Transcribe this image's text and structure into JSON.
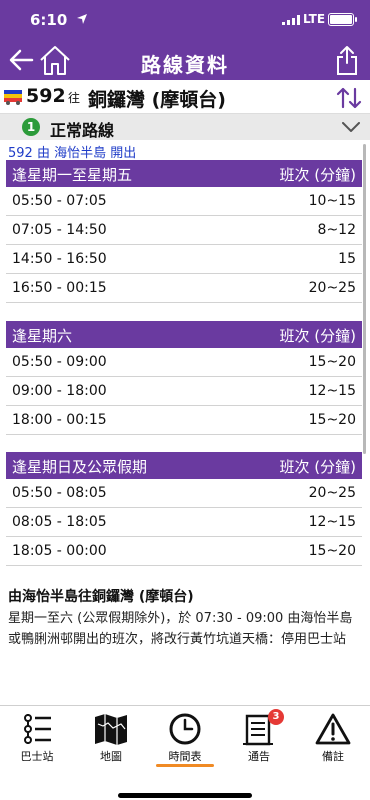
{
  "status_bar": {
    "time": "6:10",
    "network": "LTE",
    "battery_level": 1.0
  },
  "nav": {
    "title": "路線資料",
    "back_icon": "arrow-left-icon",
    "home_icon": "home-icon",
    "share_icon": "share-icon"
  },
  "route": {
    "number": "592",
    "to_word": "往",
    "destination": "銅鑼灣 (摩頓台)"
  },
  "variant": {
    "number": "1",
    "label": "正常路線"
  },
  "departure_label": "592 由 海怡半島 開出",
  "timetable": [
    {
      "title": "逢星期一至星期五",
      "unit": "班次 (分鐘)",
      "rows": [
        {
          "time": "05:50 - 07:05",
          "freq": "10~15"
        },
        {
          "time": "07:05 - 14:50",
          "freq": "8~12"
        },
        {
          "time": "14:50 - 16:50",
          "freq": "15"
        },
        {
          "time": "16:50 - 00:15",
          "freq": "20~25"
        }
      ]
    },
    {
      "title": "逢星期六",
      "unit": "班次 (分鐘)",
      "rows": [
        {
          "time": "05:50 - 09:00",
          "freq": "15~20"
        },
        {
          "time": "09:00 - 18:00",
          "freq": "12~15"
        },
        {
          "time": "18:00 - 00:15",
          "freq": "15~20"
        }
      ]
    },
    {
      "title": "逢星期日及公眾假期",
      "unit": "班次 (分鐘)",
      "rows": [
        {
          "time": "05:50 - 08:05",
          "freq": "20~25"
        },
        {
          "time": "08:05 - 18:05",
          "freq": "12~15"
        },
        {
          "time": "18:05 - 00:00",
          "freq": "15~20"
        }
      ]
    }
  ],
  "note": {
    "title": "由海怡半島往銅鑼灣 (摩頓台)",
    "body": "星期一至六 (公眾假期除外)，於 07:30 - 09:00 由海怡半島或鴨脷洲邨開出的班次，將改行黃竹坑道天橋：停用巴士站"
  },
  "tabs": [
    {
      "label": "巴士站",
      "icon": "bus-stop-list-icon"
    },
    {
      "label": "地圖",
      "icon": "map-icon"
    },
    {
      "label": "時間表",
      "icon": "clock-icon",
      "active": true
    },
    {
      "label": "通告",
      "icon": "notice-icon",
      "badge": "3"
    },
    {
      "label": "備註",
      "icon": "warning-icon"
    }
  ],
  "colors": {
    "brand": "#6a3aa0",
    "active_tab_underline": "#f08a24",
    "badge": "#e53935",
    "variant_circle": "#2c9b3a",
    "departure_text": "#1f3cc8"
  }
}
